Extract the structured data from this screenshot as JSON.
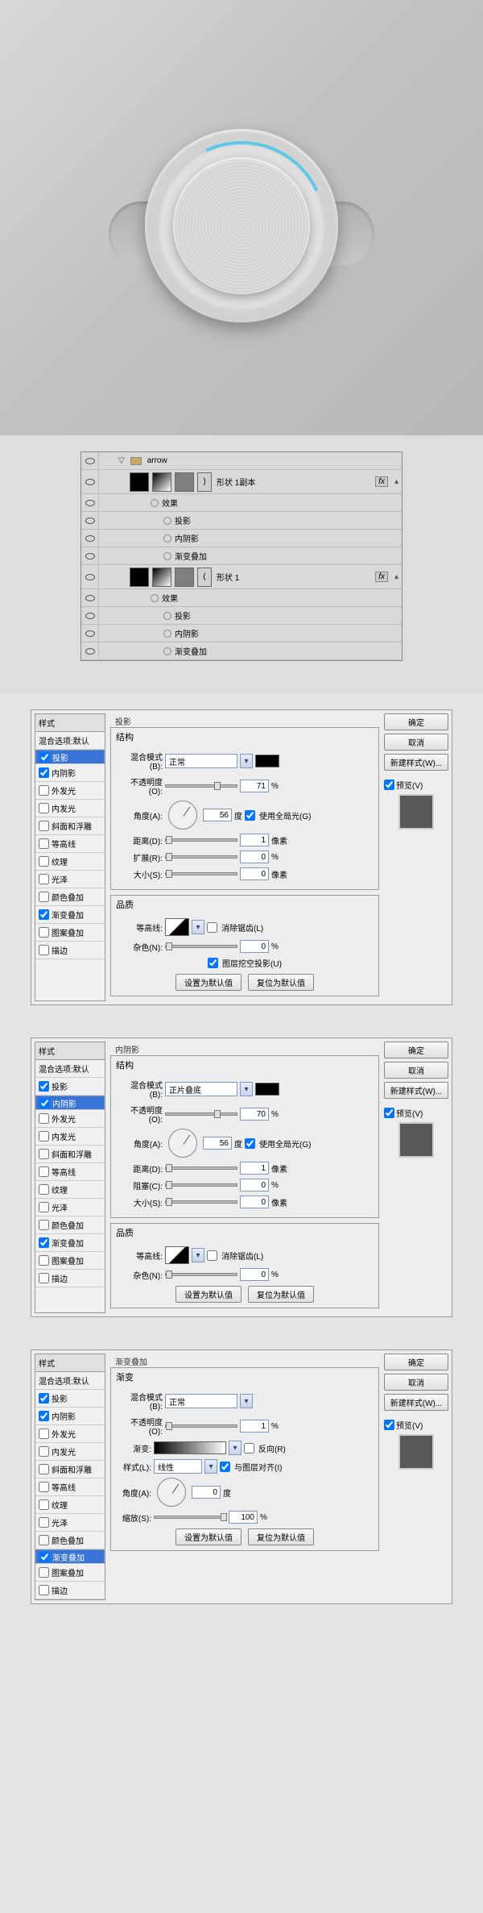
{
  "layers": {
    "group_name": "arrow",
    "shape1_copy": "形状 1副本",
    "shape1": "形状 1",
    "effects": "效果",
    "drop_shadow": "投影",
    "inner_shadow": "内阴影",
    "gradient_overlay": "渐变叠加",
    "fx": "fx"
  },
  "styles": {
    "header": "样式",
    "blend_default": "混合选项:默认",
    "drop_shadow": "投影",
    "inner_shadow": "内阴影",
    "outer_glow": "外发光",
    "inner_glow": "内发光",
    "bevel_emboss": "斜面和浮雕",
    "contour": "等高线",
    "texture": "纹理",
    "satin": "光泽",
    "color_overlay": "颜色叠加",
    "gradient_overlay": "渐变叠加",
    "pattern_overlay": "图案叠加",
    "stroke": "描边"
  },
  "buttons": {
    "ok": "确定",
    "cancel": "取消",
    "new_style": "新建样式(W)...",
    "preview": "预览(V)",
    "set_default": "设置为默认值",
    "reset_default": "复位为默认值"
  },
  "labels": {
    "structure": "结构",
    "quality": "品质",
    "gradient_section": "渐变",
    "blend_mode": "混合模式(B):",
    "opacity": "不透明度(O):",
    "angle": "角度(A):",
    "degree": "度",
    "use_global": "使用全局光(G)",
    "distance": "距离(D):",
    "spread": "扩展(R):",
    "choke": "阻塞(C):",
    "size": "大小(S):",
    "pixels": "像素",
    "percent": "%",
    "contour_label": "等高线:",
    "anti_alias": "消除锯齿(L)",
    "noise": "杂色(N):",
    "knockout": "图层挖空投影(U)",
    "gradient": "渐变:",
    "reverse": "反向(R)",
    "style_lbl": "样式(L):",
    "linear": "线性",
    "align_layer": "与图层对齐(I)",
    "scale": "缩放(S):",
    "normal": "正常",
    "multiply": "正片叠底"
  },
  "panel1": {
    "title": "投影",
    "opacity": "71",
    "angle": "56",
    "distance": "1",
    "spread": "0",
    "size": "0",
    "noise": "0"
  },
  "panel2": {
    "title": "内阴影",
    "opacity": "70",
    "angle": "56",
    "distance": "1",
    "spread": "0",
    "size": "0",
    "noise": "0"
  },
  "panel3": {
    "title": "渐变叠加",
    "opacity": "1",
    "angle": "0",
    "scale": "100"
  }
}
